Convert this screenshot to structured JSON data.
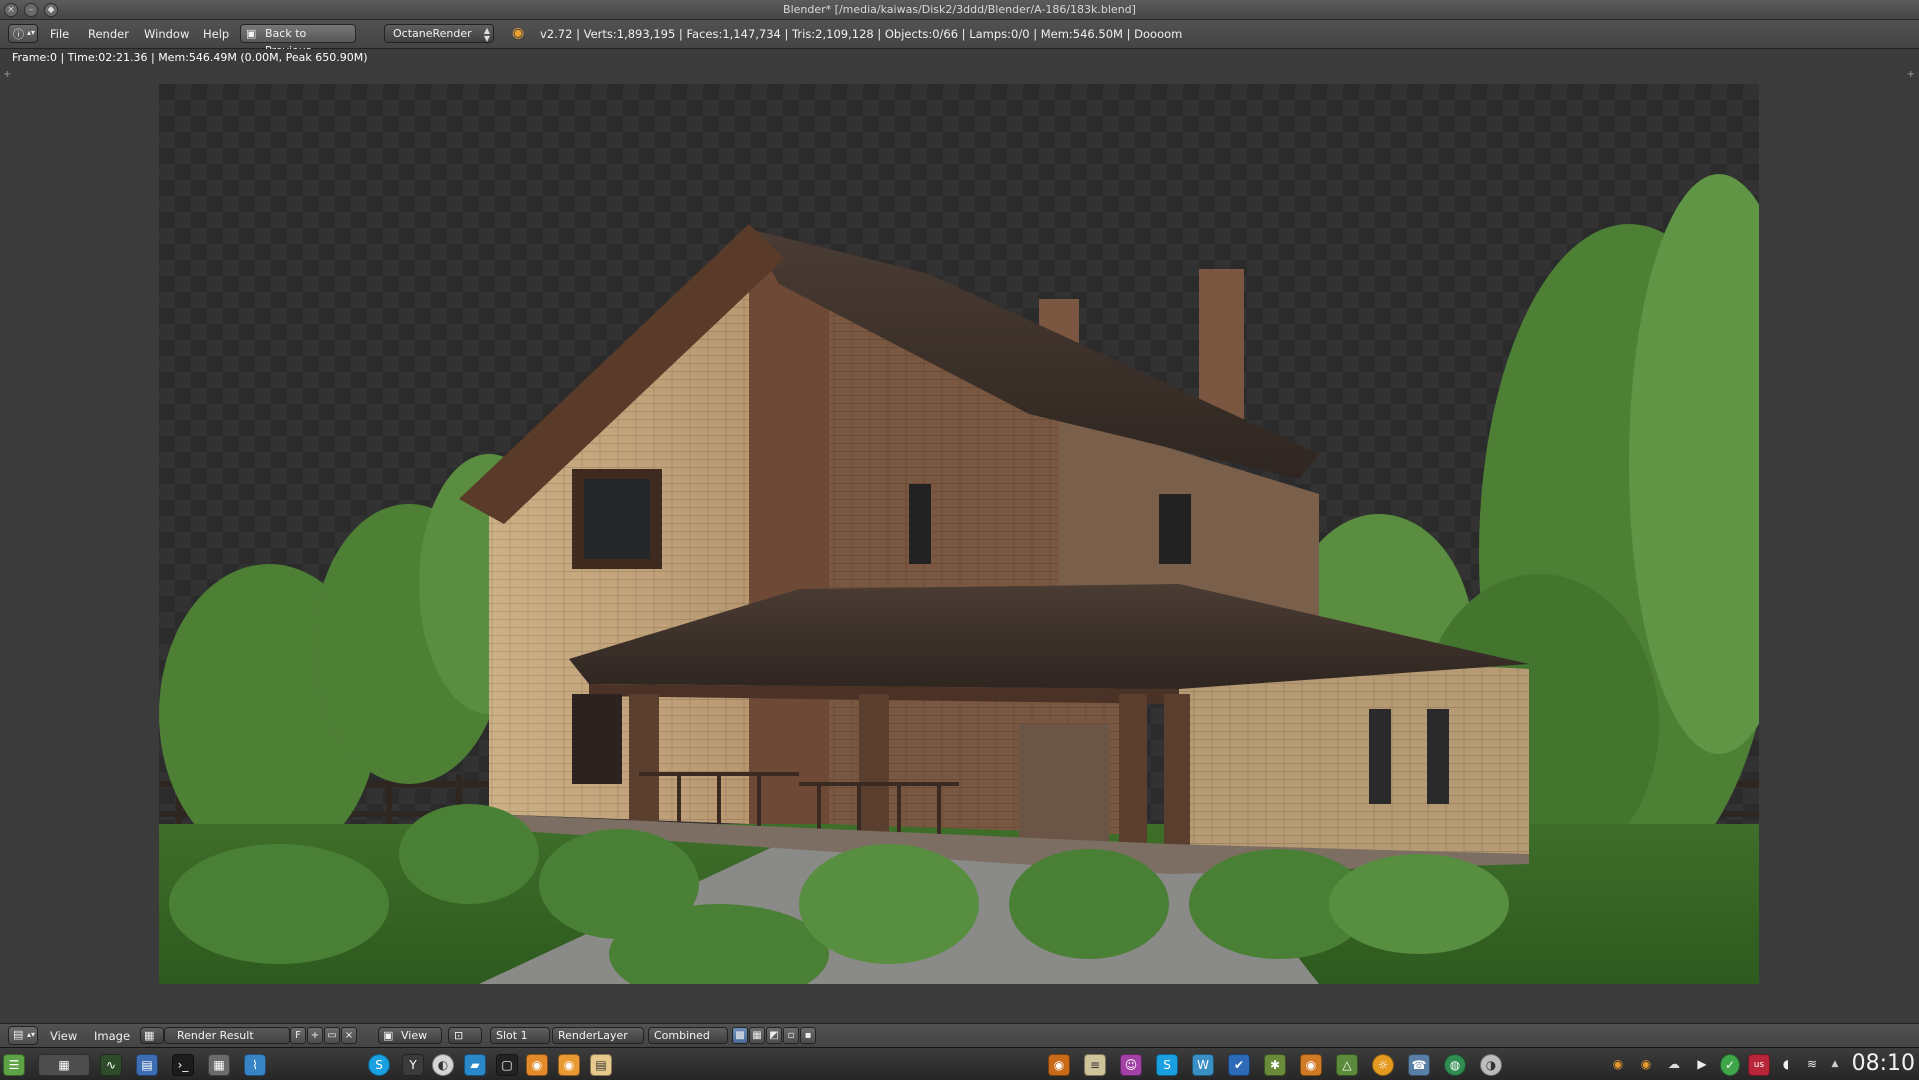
{
  "window": {
    "title": "Blender* [/media/kaiwas/Disk2/3ddd/Blender/A-186/183k.blend]",
    "controls": [
      "close",
      "minimize",
      "maximize"
    ]
  },
  "info_header": {
    "editor_icon": "info-icon",
    "menus": [
      "File",
      "Render",
      "Window",
      "Help"
    ],
    "back_button": "Back to Previous",
    "render_engine": "OctaneRender",
    "stats": "v2.72 | Verts:1,893,195 | Faces:1,147,734 | Tris:2,109,128 | Objects:0/66 | Lamps:0/0 | Mem:546.50M | Doooom"
  },
  "image_editor": {
    "render_info": "Frame:0 | Time:02:21.36 | Mem:546.49M (0.00M, Peak 650.90M)",
    "image_alt": "Rendered scene: two-storey brick house with brown roof, porch, surrounded by weeping trees and lawn"
  },
  "image_header": {
    "menus": [
      "View",
      "Image"
    ],
    "image_name": "Render Result",
    "fake_user": "F",
    "view_dropdown": "View",
    "slot": "Slot 1",
    "render_layer": "RenderLayer",
    "pass": "Combined"
  },
  "taskbar": {
    "left_icons": [
      "app-menu-icon",
      "workspace-switcher-icon",
      "system-monitor-icon",
      "desktop-icon",
      "terminal-icon",
      "calculator-icon",
      "graph-icon"
    ],
    "center_icons": [
      "skype-icon",
      "yakuake-icon",
      "browser-icon",
      "file-manager-icon",
      "console-icon",
      "blender-icon",
      "blender-alt-icon",
      "notes-icon"
    ],
    "tray_icons": [
      "blender-tray-icon",
      "blender-tray-2-icon",
      "cloud-icon",
      "media-play-icon",
      "check-icon",
      "keyboard-layout-icon",
      "volume-icon",
      "network-icon",
      "expand-tray-icon"
    ],
    "clock": "08:10"
  },
  "colors": {
    "header_bg": "#4a4a4a",
    "editor_bg": "#3b3b3b",
    "taskbar_bg": "#2e2e2e",
    "accent": "#5680c2"
  }
}
